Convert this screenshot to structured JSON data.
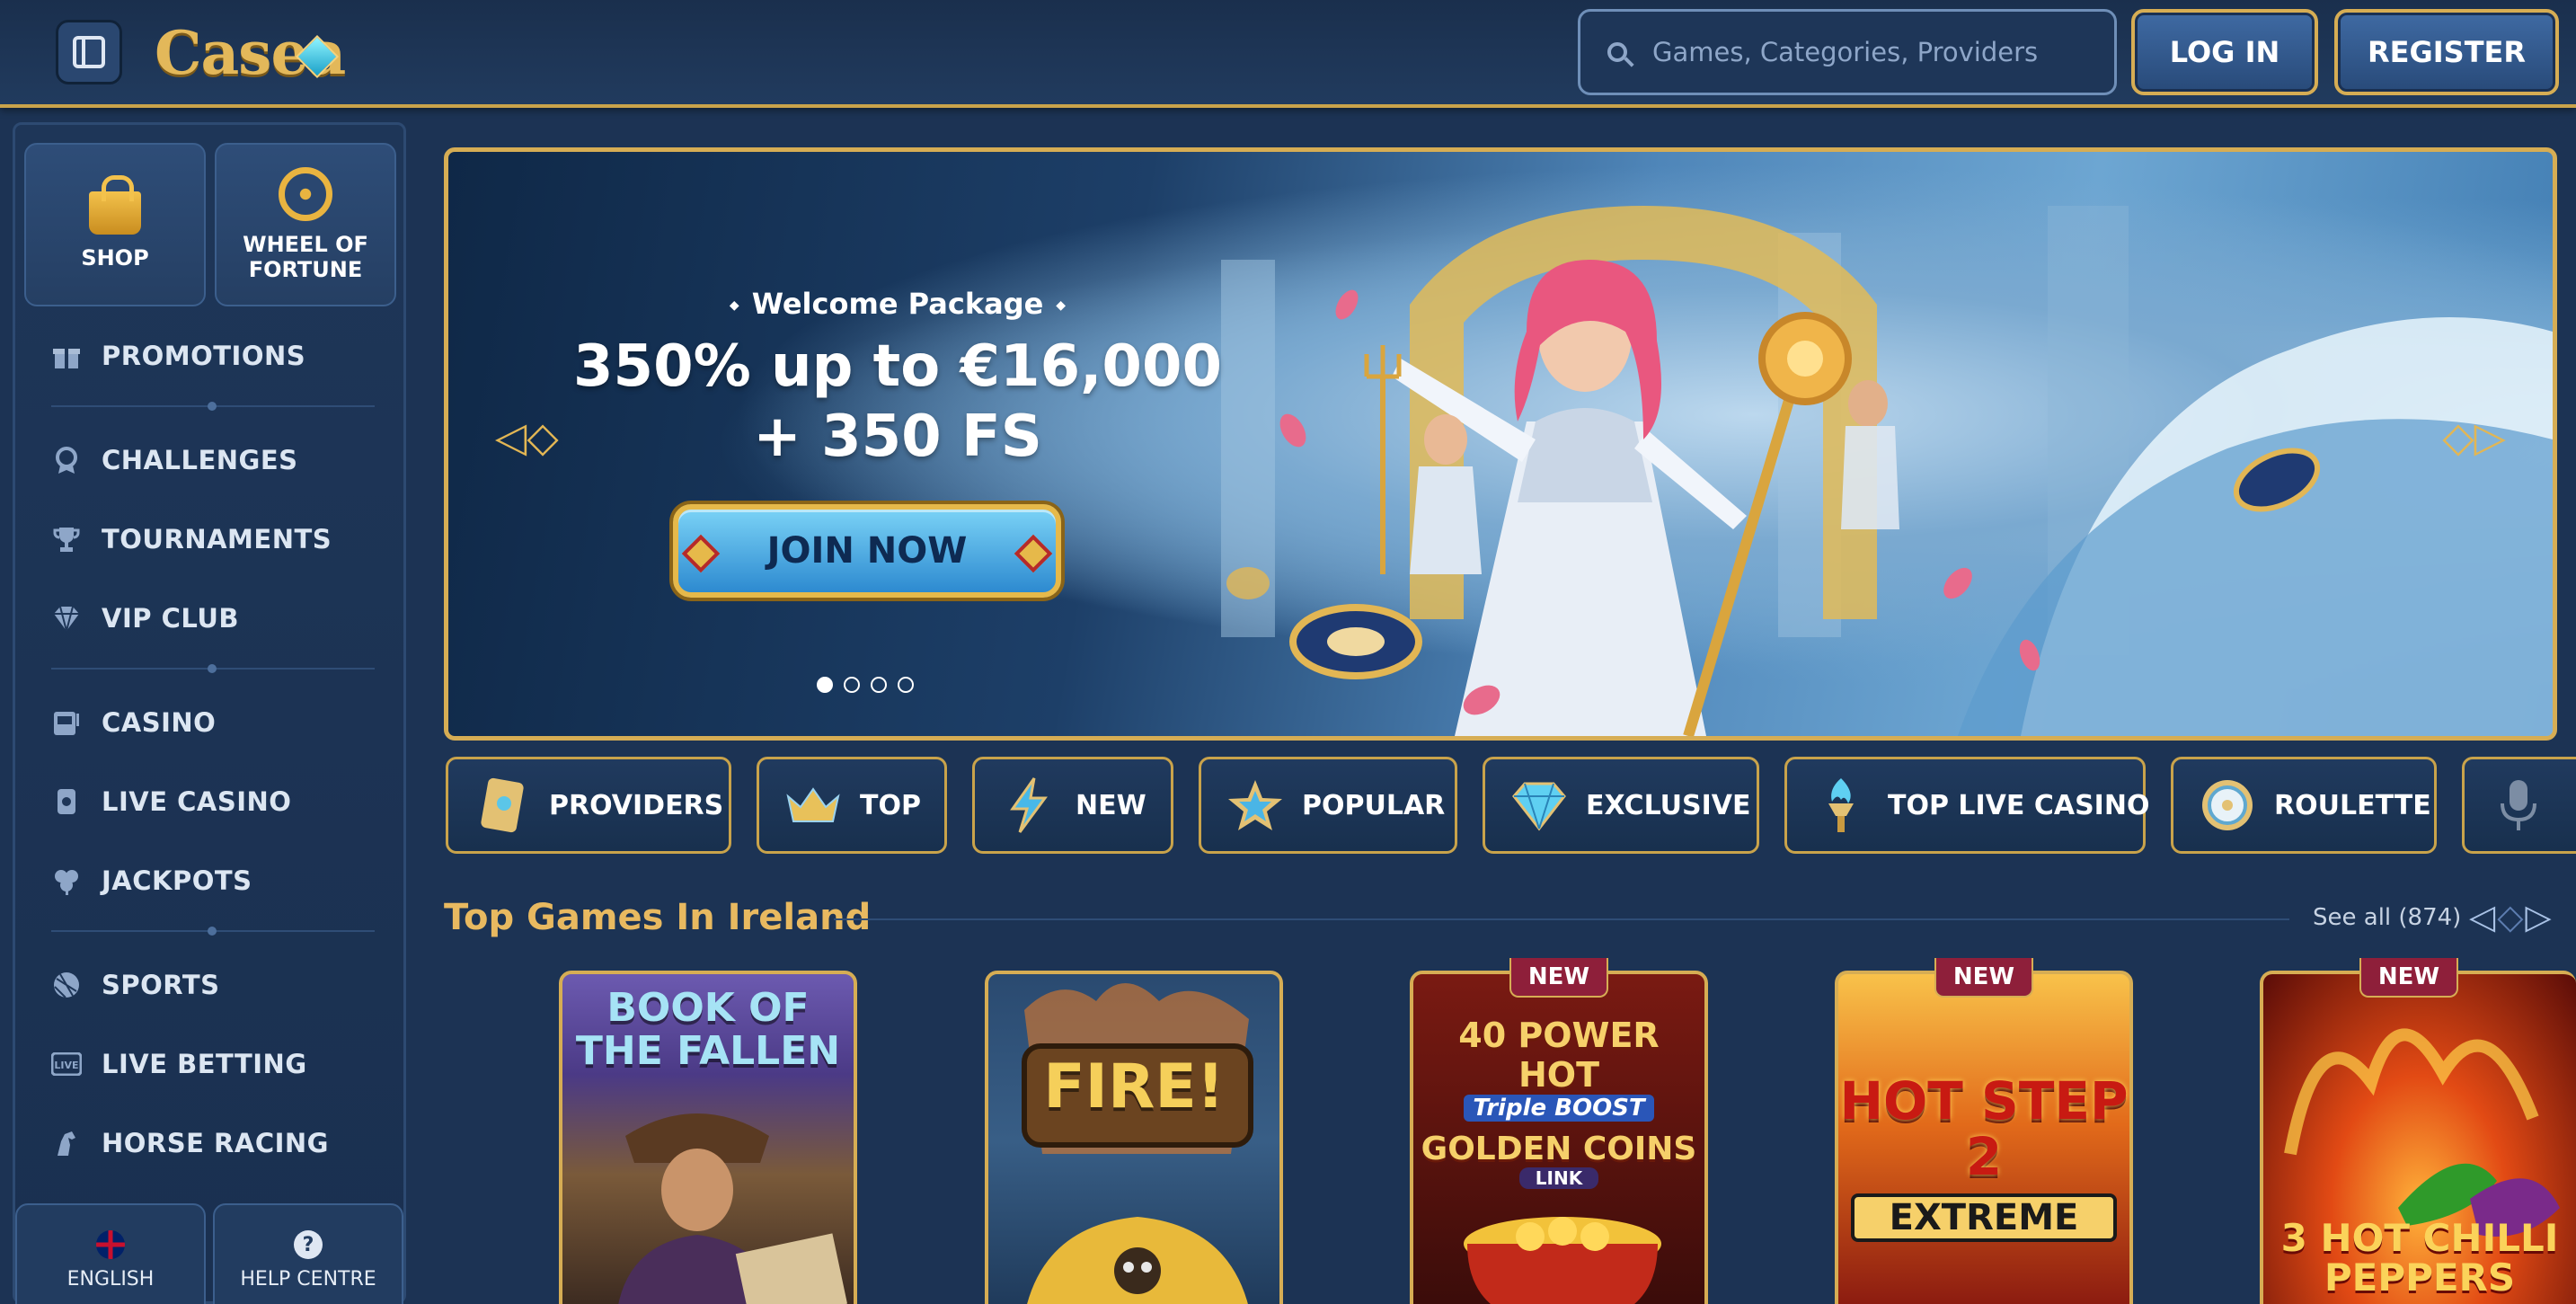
{
  "header": {
    "logo_text": "Casea",
    "search_placeholder": "Games, Categories, Providers",
    "login_label": "LOG IN",
    "register_label": "REGISTER"
  },
  "sidebar": {
    "tiles": [
      {
        "label": "SHOP",
        "icon": "shopping-bag-icon"
      },
      {
        "label": "WHEEL OF FORTUNE",
        "icon": "wheel-icon"
      }
    ],
    "items": [
      {
        "label": "PROMOTIONS",
        "icon": "gift-icon"
      },
      {
        "label": "CHALLENGES",
        "icon": "medal-icon"
      },
      {
        "label": "TOURNAMENTS",
        "icon": "trophy-icon"
      },
      {
        "label": "VIP CLUB",
        "icon": "diamond-icon"
      },
      {
        "label": "CASINO",
        "icon": "slot-machine-icon"
      },
      {
        "label": "LIVE CASINO",
        "icon": "live-casino-icon"
      },
      {
        "label": "JACKPOTS",
        "icon": "clover-icon"
      },
      {
        "label": "SPORTS",
        "icon": "ball-icon"
      },
      {
        "label": "LIVE BETTING",
        "icon": "live-badge-icon"
      },
      {
        "label": "HORSE RACING",
        "icon": "horse-icon"
      }
    ],
    "footer": {
      "language_label": "ENGLISH",
      "help_label": "HELP CENTRE"
    }
  },
  "hero": {
    "subtitle": "Welcome Package",
    "title_line1": "350% up to €16,000",
    "title_line2": "+ 350 FS",
    "cta_label": "JOIN NOW",
    "slide_count": 4,
    "active_slide": 1
  },
  "categories": [
    {
      "label": "PROVIDERS",
      "icon": "card-icon"
    },
    {
      "label": "TOP",
      "icon": "crown-icon"
    },
    {
      "label": "NEW",
      "icon": "lightning-icon"
    },
    {
      "label": "POPULAR",
      "icon": "star-icon"
    },
    {
      "label": "EXCLUSIVE",
      "icon": "diamond-icon"
    },
    {
      "label": "TOP LIVE CASINO",
      "icon": "torch-icon"
    },
    {
      "label": "ROULETTE",
      "icon": "roulette-icon"
    },
    {
      "label": "",
      "icon": "microphone-icon"
    }
  ],
  "top_games": {
    "title": "Top Games In Ireland",
    "see_all": "See all (874)",
    "games": [
      {
        "title": "BOOK OF THE FALLEN",
        "badge": ""
      },
      {
        "title": "FIRE!",
        "badge": ""
      },
      {
        "title": "40 POWER HOT",
        "subtitle": "Triple BOOST",
        "subtitle2": "GOLDEN COINS",
        "subtitle3": "LINK",
        "badge": "NEW"
      },
      {
        "title": "HOT STEP 2",
        "subtitle": "EXTREME",
        "badge": "NEW"
      },
      {
        "title": "3 HOT CHILLI PEPPERS",
        "badge": "NEW"
      }
    ]
  },
  "colors": {
    "background": "#1c3354",
    "gold_accent": "#d6ad54",
    "section_title": "#e8b960",
    "new_badge": "#8e1f3a"
  }
}
